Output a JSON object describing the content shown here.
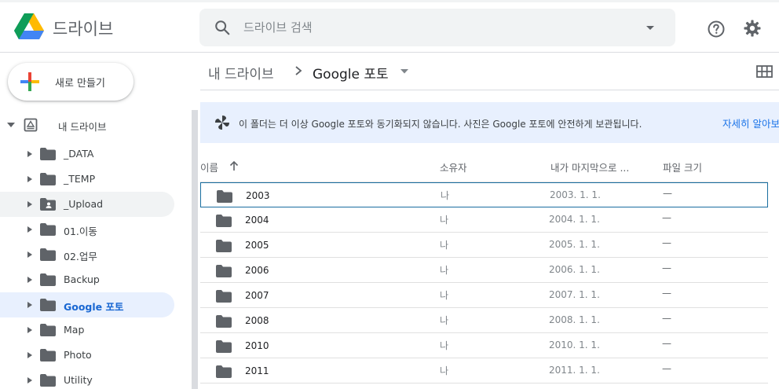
{
  "app": {
    "title": "드라이브"
  },
  "search": {
    "placeholder": "드라이브 검색"
  },
  "sidebar": {
    "new_label": "새로 만들기",
    "root_label": "내 드라이브",
    "items": [
      {
        "label": "_DATA",
        "icon": "folder-icon"
      },
      {
        "label": "_TEMP",
        "icon": "folder-icon"
      },
      {
        "label": "_Upload",
        "icon": "shared-folder-icon"
      },
      {
        "label": "01.이동",
        "icon": "folder-icon"
      },
      {
        "label": "02.업무",
        "icon": "folder-icon"
      },
      {
        "label": "Backup",
        "icon": "folder-icon"
      },
      {
        "label": "Google 포토",
        "icon": "folder-icon"
      },
      {
        "label": "Map",
        "icon": "folder-icon"
      },
      {
        "label": "Photo",
        "icon": "folder-icon"
      },
      {
        "label": "Utility",
        "icon": "folder-icon"
      }
    ]
  },
  "breadcrumb": {
    "root": "내 드라이브",
    "current": "Google 포토"
  },
  "banner": {
    "message": "이 폴더는 더 이상 Google 포토와 동기화되지 않습니다. 사진은 Google 포토에 안전하게 보관됩니다.",
    "link": "자세히 알아보기"
  },
  "table": {
    "columns": {
      "name": "이름",
      "owner": "소유자",
      "modified": "내가 마지막으로 ...",
      "size": "파일 크기"
    },
    "rows": [
      {
        "name": "2003",
        "owner": "나",
        "modified": "2003. 1. 1.",
        "size": "—"
      },
      {
        "name": "2004",
        "owner": "나",
        "modified": "2004. 1. 1.",
        "size": "—"
      },
      {
        "name": "2005",
        "owner": "나",
        "modified": "2005. 1. 1.",
        "size": "—"
      },
      {
        "name": "2006",
        "owner": "나",
        "modified": "2006. 1. 1.",
        "size": "—"
      },
      {
        "name": "2007",
        "owner": "나",
        "modified": "2007. 1. 1.",
        "size": "—"
      },
      {
        "name": "2008",
        "owner": "나",
        "modified": "2008. 1. 1.",
        "size": "—"
      },
      {
        "name": "2010",
        "owner": "나",
        "modified": "2010. 1. 1.",
        "size": "—"
      },
      {
        "name": "2011",
        "owner": "나",
        "modified": "2011. 1. 1.",
        "size": "—"
      }
    ]
  },
  "colors": {
    "accent": "#1a73e8",
    "selected_bg": "#e8f0fe",
    "folder": "#5f6368"
  }
}
